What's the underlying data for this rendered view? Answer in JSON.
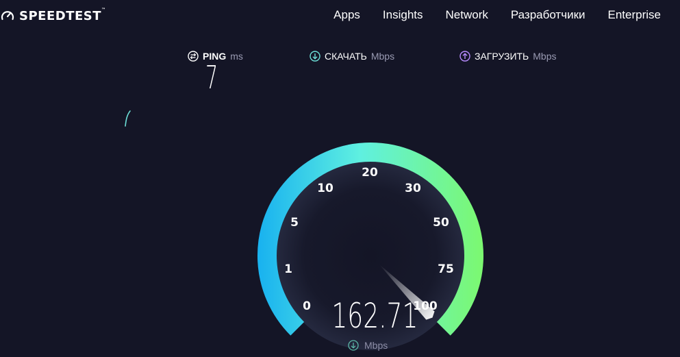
{
  "header": {
    "logo_text": "SPEEDTEST",
    "logo_tm": "™",
    "nav": [
      "Apps",
      "Insights",
      "Network",
      "Разработчики",
      "Enterprise"
    ]
  },
  "results": {
    "ping": {
      "label": "PING",
      "unit": "ms",
      "value": "7",
      "icon": "ping-icon"
    },
    "download": {
      "label": "СКАЧАТЬ",
      "unit": "Mbps",
      "icon": "download-arrow-icon",
      "color": "#6de0d8"
    },
    "upload": {
      "label": "ЗАГРУЗИТЬ",
      "unit": "Mbps",
      "icon": "upload-arrow-icon",
      "color": "#b98cff"
    }
  },
  "gauge": {
    "ticks": [
      "0",
      "1",
      "5",
      "10",
      "20",
      "30",
      "50",
      "75",
      "100"
    ],
    "current_value": "162.71",
    "unit": "Mbps",
    "level_fraction": 1.0
  },
  "colors": {
    "background": "#141526",
    "gauge_start": "#1ab3ef",
    "gauge_mid": "#5ff0e0",
    "gauge_end": "#7cf870"
  }
}
